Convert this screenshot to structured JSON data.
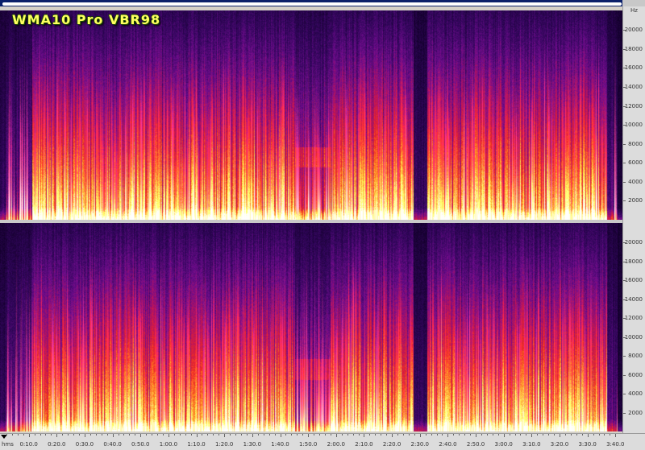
{
  "title": "WMA10 Pro VBR98",
  "frequency_axis": {
    "unit": "Hz",
    "ticks": [
      "20000",
      "18000",
      "16000",
      "14000",
      "12000",
      "10000",
      "8000",
      "6000",
      "4000",
      "2000"
    ]
  },
  "time_axis": {
    "unit": "hms",
    "ticks": [
      "0:10.0",
      "0:20.0",
      "0:30.0",
      "0:40.0",
      "0:50.0",
      "1:00.0",
      "1:10.0",
      "1:20.0",
      "1:30.0",
      "1:40.0",
      "1:50.0",
      "2:00.0",
      "2:10.0",
      "2:20.0",
      "2:30.0",
      "2:40.0",
      "2:50.0",
      "3:00.0",
      "3:10.0",
      "3:20.0",
      "3:30.0",
      "3:40.0"
    ]
  },
  "channels": [
    "top",
    "bottom"
  ],
  "colors": {
    "background_dark": "#12002a",
    "mid_purple": "#6a0a8a",
    "hot_red": "#e01a2a",
    "orange": "#ff8a1a",
    "hot_yellow": "#fff8a0",
    "title_text": "#ffff60",
    "title_outline": "#1a4a00"
  }
}
